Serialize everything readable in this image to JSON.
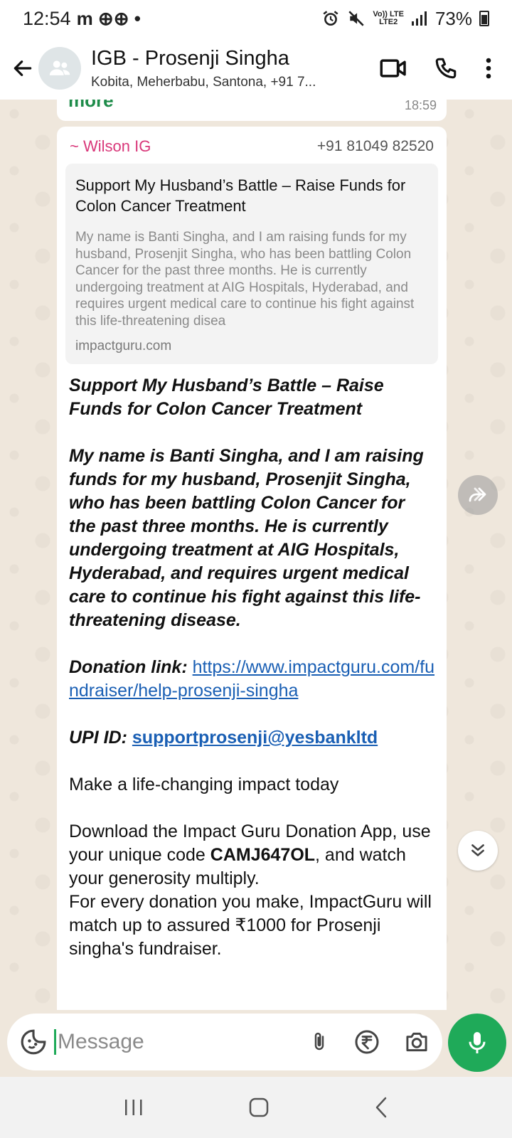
{
  "status_bar": {
    "time": "12:54",
    "left_glyphs": "m ⊕⊕ •",
    "network_top": "Vo)) LTE",
    "network_bottom": "LTE2",
    "battery": "73%"
  },
  "header": {
    "title": "IGB - Prosenji Singha",
    "subtitle": "Kobita, Meherbabu, Santona, +91 7..."
  },
  "previous_message": {
    "partial_text": "more",
    "time": "18:59"
  },
  "message": {
    "sender": "~ Wilson IG",
    "sender_phone": "+91 81049 82520",
    "sender_color": "#d9387a",
    "link_preview": {
      "title": "Support My Husband’s Battle – Raise Funds for Colon Cancer Treatment",
      "description": "My name is Banti Singha, and I am raising funds for my husband, Prosenjit Singha, who has been battling Colon Cancer for the past three months. He is currently undergoing treatment at AIG Hospitals, Hyderabad, and requires urgent medical care to continue his fight against this life-threatening disea",
      "domain": "impactguru.com"
    },
    "heading": "Support My Husband’s Battle – Raise Funds for Colon Cancer Treatment",
    "story": "My name is Banti Singha, and I am raising funds for my husband, Prosenjit Singha, who has been battling Colon Cancer for the past three months. He is currently undergoing treatment at AIG Hospitals, Hyderabad, and requires urgent medical care to continue his fight against this life-threatening disease.",
    "donation_label": "Donation link:",
    "donation_url": "https://www.impactguru.com/fundraiser/help-prosenji-singha",
    "upi_label": "UPI ID:",
    "upi_id": "supportprosenji@yesbankltd",
    "impact_line": "Make a life-changing impact today",
    "download_pre": "Download the Impact Guru Donation App, use your unique code ",
    "code": "CAMJ647OL",
    "download_post": ", and watch your generosity multiply.",
    "match_line": "For every donation you make, ImpactGuru will match up to assured ₹1000 for Prosenji singha's fundraiser."
  },
  "input": {
    "placeholder": "Message"
  },
  "icons": {
    "back": "arrow-left-icon",
    "avatar": "group-avatar-icon",
    "video": "video-call-icon",
    "call": "phone-call-icon",
    "menu": "more-vert-icon",
    "forward": "forward-icon",
    "scroll_down": "double-chevron-down-icon",
    "sticker": "sticker-icon",
    "attach": "paperclip-icon",
    "payment": "rupee-icon",
    "camera": "camera-icon",
    "mic": "mic-icon"
  },
  "colors": {
    "accent_green": "#1faa59",
    "link_blue": "#1a5fb4",
    "chat_bg": "#efe7dc"
  }
}
